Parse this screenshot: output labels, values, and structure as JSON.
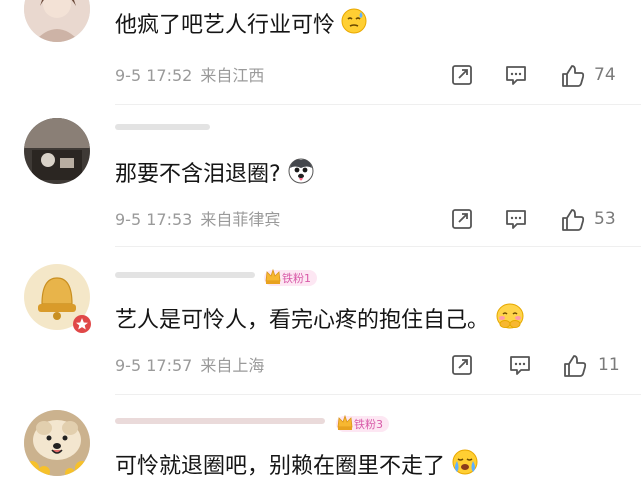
{
  "comments": [
    {
      "text": "他疯了吧艺人行业可怜",
      "emoji": "sweat-face-emoji",
      "date": "9-5 17:52",
      "location": "来自江西",
      "likes": "74"
    },
    {
      "text": "那要不含泪退圈?",
      "emoji": "husky-dog-emoji",
      "date": "9-5 17:53",
      "location": "来自菲律宾",
      "likes": "53"
    },
    {
      "badge": "铁粉1",
      "text": "艺人是可怜人，看完心疼的抱住自己。",
      "emoji": "hug-self-emoji",
      "date": "9-5 17:57",
      "location": "来自上海",
      "likes": "11"
    },
    {
      "badge": "铁粉3",
      "text": "可怜就退圈吧，别赖在圈里不走了",
      "emoji": "crying-face-emoji"
    }
  ],
  "icons": {
    "share": "share-icon",
    "comment": "comment-icon",
    "like": "thumbs-up-icon"
  },
  "colors": {
    "meta_text": "#9a9a9a",
    "badge_bg": "#fde7f3",
    "badge_text": "#d85aa8"
  }
}
